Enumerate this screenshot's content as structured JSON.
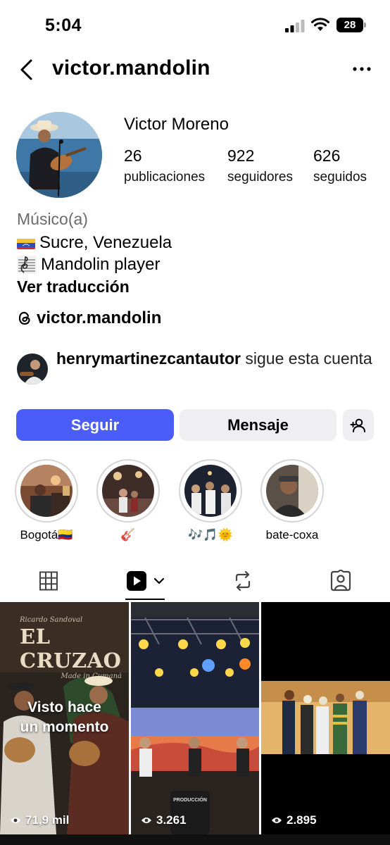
{
  "status_bar": {
    "time": "5:04",
    "battery": "28"
  },
  "header": {
    "username": "victor.mandolin"
  },
  "profile": {
    "display_name": "Victor Moreno",
    "stats": [
      {
        "value": "26",
        "label": "publicaciones"
      },
      {
        "value": "922",
        "label": "seguidores"
      },
      {
        "value": "626",
        "label": "seguidos"
      }
    ],
    "category": "Músico(a)",
    "bio_lines": [
      "Sucre, Venezuela",
      "Mandolin player"
    ],
    "translate_label": "Ver traducción",
    "threads_handle": "victor.mandolin"
  },
  "followed_by": {
    "username": "henrymartinezcantautor",
    "text": " sigue esta cuenta"
  },
  "actions": {
    "follow": "Seguir",
    "message": "Mensaje"
  },
  "highlights": [
    {
      "label": "Bogotá🇨🇴"
    },
    {
      "label": "🎸"
    },
    {
      "label": "🎶🎵🌞"
    },
    {
      "label": "bate-coxa"
    }
  ],
  "reels": [
    {
      "views": "71,9 mil",
      "overlay": [
        "Visto hace",
        "un momento"
      ],
      "poster_small_top": "Ricardo Sandoval",
      "poster_title": "EL CRUZAO",
      "poster_small_bottom": "Made in Cumaná"
    },
    {
      "views": "3.261",
      "sign": "PRODUCCIÓN"
    },
    {
      "views": "2.895"
    }
  ],
  "colors": {
    "follow_button": "#4a5df9",
    "secondary_button": "#efeff1"
  }
}
